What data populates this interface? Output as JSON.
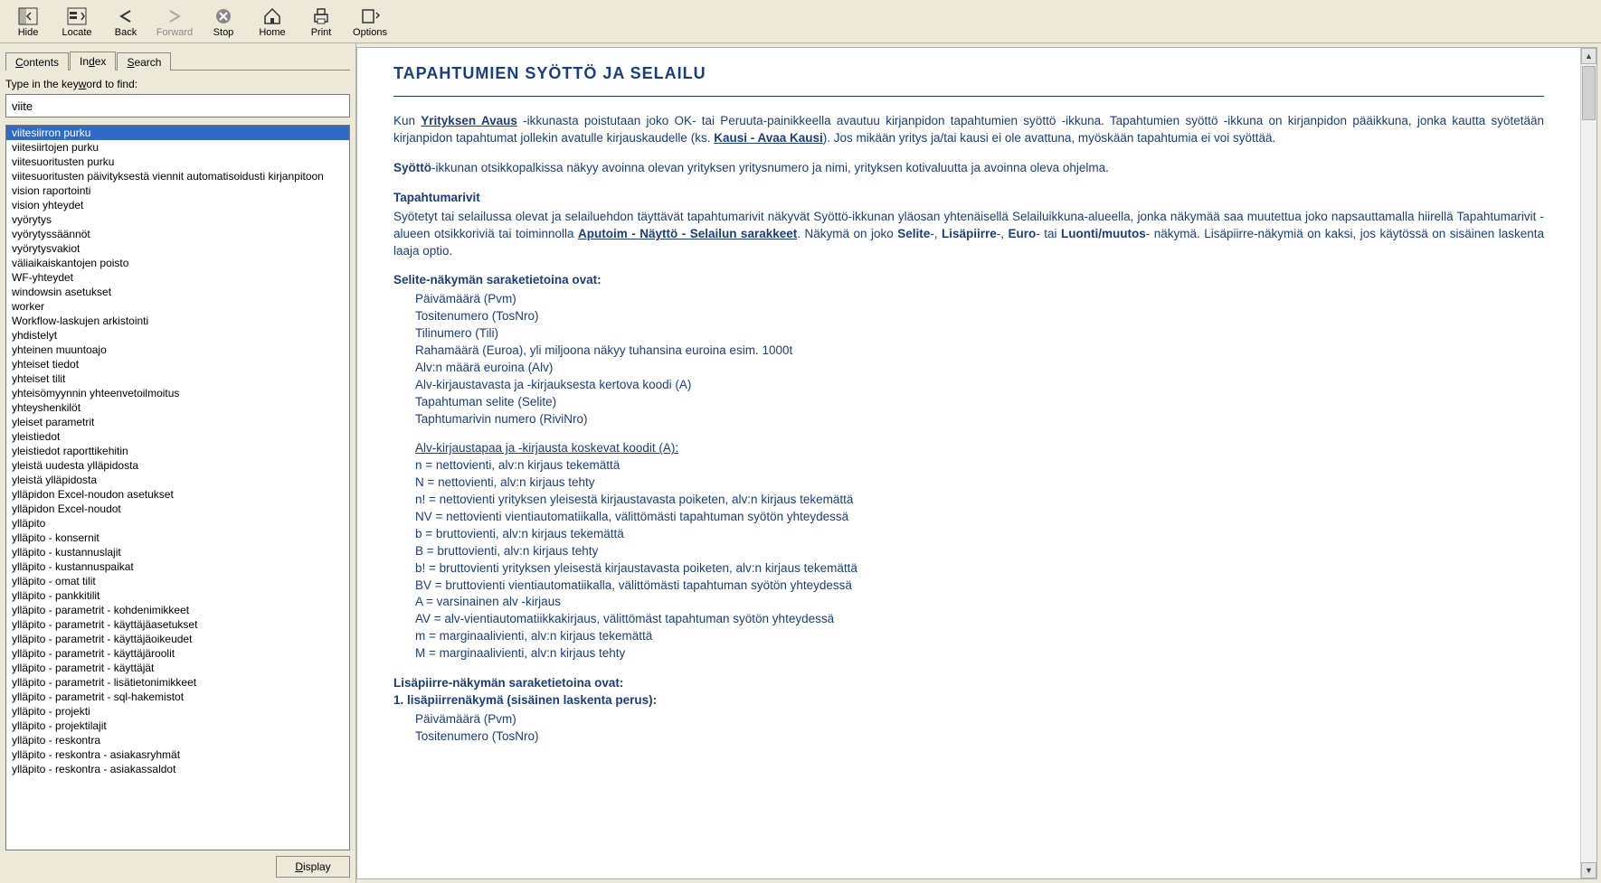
{
  "toolbar": {
    "hide": "Hide",
    "locate": "Locate",
    "back": "Back",
    "forward": "Forward",
    "stop": "Stop",
    "home": "Home",
    "print": "Print",
    "options": "Options"
  },
  "tabs": {
    "contents": "Contents",
    "index": "Index",
    "search": "Search"
  },
  "left": {
    "prompt": "Type in the keyword to find:",
    "input_value": "viite",
    "display_btn": "Display",
    "items": [
      "viitesiirron purku",
      "viitesiirtojen purku",
      "viitesuoritusten purku",
      "viitesuoritusten päivityksestä viennit automatisoidusti kirjanpitoon",
      "vision raportointi",
      "vision yhteydet",
      "vyörytys",
      "vyörytyssäännöt",
      "vyörytysvakiot",
      "väliaikaiskantojen poisto",
      "WF-yhteydet",
      "windowsin asetukset",
      "worker",
      "Workflow-laskujen arkistointi",
      "yhdistelyt",
      "yhteinen muuntoajo",
      "yhteiset tiedot",
      "yhteiset tilit",
      "yhteisömyynnin yhteenvetoilmoitus",
      "yhteyshenkilöt",
      "yleiset parametrit",
      "yleistiedot",
      "yleistiedot raporttikehitin",
      "yleistä uudesta ylläpidosta",
      "yleistä ylläpidosta",
      "ylläpidon Excel-noudon asetukset",
      "ylläpidon Excel-noudot",
      "ylläpito",
      "ylläpito - konsernit",
      "ylläpito - kustannuslajit",
      "ylläpito - kustannuspaikat",
      "ylläpito - omat tilit",
      "ylläpito - pankkitilit",
      "ylläpito - parametrit - kohdenimikkeet",
      "ylläpito - parametrit - käyttäjäasetukset",
      "ylläpito - parametrit - käyttäjäoikeudet",
      "ylläpito - parametrit - käyttäjäroolit",
      "ylläpito - parametrit - käyttäjät",
      "ylläpito - parametrit - lisätietonimikkeet",
      "ylläpito - parametrit - sql-hakemistot",
      "ylläpito - projekti",
      "ylläpito - projektilajit",
      "ylläpito - reskontra",
      "ylläpito - reskontra - asiakasryhmät",
      "ylläpito - reskontra - asiakassaldot"
    ]
  },
  "content": {
    "title": "TAPAHTUMIEN SYÖTTÖ JA SELAILU",
    "p1_a": "Kun ",
    "p1_link1": "Yrityksen Avaus",
    "p1_b": " -ikkunasta poistutaan joko OK- tai Peruuta-painikkeella avautuu kirjanpidon tapahtumien syöttö -ikkuna. Tapahtumien syöttö -ikkuna on kirjanpidon pääikkuna, jonka kautta syötetään kirjanpidon tapahtumat jollekin avatulle kirjauskaudelle (ks. ",
    "p1_link2": "Kausi - Avaa Kausi",
    "p1_c": "). Jos mikään yritys ja/tai kausi ei ole avattuna, myöskään tapahtumia ei voi syöttää.",
    "p2_a": "Syöttö",
    "p2_b": "-ikkunan otsikkopalkissa näkyy avoinna olevan yrityksen yritysnumero ja nimi, yrityksen kotivaluutta ja avoinna oleva ohjelma.",
    "sec1_title": "Tapahtumarivit",
    "p3_a": "Syötetyt tai selailussa olevat ja selailuehdon täyttävät tapahtumarivit näkyvät Syöttö-ikkunan yläosan yhtenäisellä Selailuikkuna-alueella, jonka näkymää saa muutettua joko napsauttamalla hiirellä Tapahtumarivit -alueen otsikkoriviä tai toiminnolla ",
    "p3_link": "Aputoim - Näyttö - Selailun sarakkeet",
    "p3_b": ". Näkymä on joko ",
    "p3_b1": "Selite",
    "p3_b2": "-, ",
    "p3_b3": "Lisäpiirre",
    "p3_b4": "-, ",
    "p3_b5": "Euro",
    "p3_b6": "- tai ",
    "p3_b7": "Luonti/muutos",
    "p3_b8": "- näkymä. Lisäpiirre-näkymiä on kaksi, jos käytössä on sisäinen laskenta laaja optio.",
    "sec2_title": "Selite-näkymän saraketietoina ovat:",
    "sel_cols": [
      "Päivämäärä (Pvm)",
      "Tositenumero (TosNro)",
      "Tilinumero (Tili)",
      "Rahamäärä (Euroa), yli miljoona näkyy tuhansina euroina esim. 1000t",
      "Alv:n määrä euroina (Alv)",
      "Alv-kirjaustavasta ja -kirjauksesta kertova koodi (A)",
      "Tapahtuman selite (Selite)",
      "Taphtumarivin numero (RiviNro)"
    ],
    "alv_title": "Alv-kirjaustapaa ja -kirjausta koskevat koodit (A):",
    "alv_codes": [
      "n = nettovienti, alv:n kirjaus tekemättä",
      "N = nettovienti, alv:n kirjaus tehty",
      "n! = nettovienti yrityksen yleisestä kirjaustavasta poiketen, alv:n kirjaus tekemättä",
      "NV = nettovienti vientiautomatiikalla, välittömästi tapahtuman syötön yhteydessä",
      "b = bruttovienti, alv:n kirjaus tekemättä",
      "B = bruttovienti, alv:n kirjaus tehty",
      "b! = bruttovienti yrityksen yleisestä kirjaustavasta poiketen, alv:n kirjaus tekemättä",
      "BV = bruttovienti vientiautomatiikalla, välittömästi tapahtuman syötön yhteydessä",
      "A = varsinainen alv -kirjaus",
      "AV = alv-vientiautomatiikkakirjaus, välittömäst tapahtuman syötön yhteydessä",
      "m = marginaalivienti, alv:n kirjaus tekemättä",
      "M = marginaalivienti, alv:n kirjaus tehty"
    ],
    "sec3_title": "Lisäpiirre-näkymän saraketietoina ovat:",
    "sec3_sub": "1. lisäpiirrenäkymä (sisäinen laskenta perus):",
    "lisa_cols": [
      "Päivämäärä (Pvm)",
      "Tositenumero (TosNro)"
    ]
  }
}
